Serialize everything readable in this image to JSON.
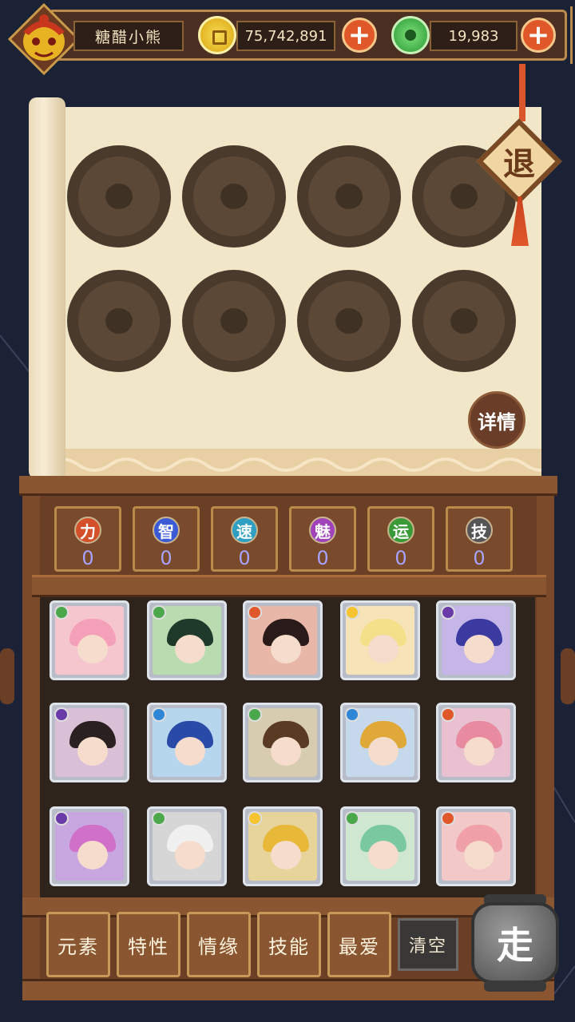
{
  "player": {
    "name": "糖醋小熊",
    "avatar_icon": "golden-mask-icon"
  },
  "currency": {
    "gold": {
      "value": "75,742,891",
      "icon": "gold-coin-icon",
      "color": "#f3c623"
    },
    "jade": {
      "value": "19,983",
      "icon": "jade-coin-icon",
      "color": "#3dbb4a"
    },
    "add_label": "+"
  },
  "exit_label": "退",
  "detail_label": "详情",
  "slot_count": 8,
  "stats": [
    {
      "label": "力",
      "value": "0",
      "color": "#d4502a"
    },
    {
      "label": "智",
      "value": "0",
      "color": "#3b5bd6"
    },
    {
      "label": "速",
      "value": "0",
      "color": "#2e9ec2"
    },
    {
      "label": "魅",
      "value": "0",
      "color": "#a043b8"
    },
    {
      "label": "运",
      "value": "0",
      "color": "#3a9a38"
    },
    {
      "label": "技",
      "value": "0",
      "color": "#555555"
    }
  ],
  "heroes": [
    {
      "element": "wood",
      "elem_color": "#4aa84a",
      "bg": "#f6c6cf",
      "hair": "#f4a0b8"
    },
    {
      "element": "wood",
      "elem_color": "#4aa84a",
      "bg": "#b8dbb0",
      "hair": "#1f3a2a"
    },
    {
      "element": "fire",
      "elem_color": "#e0582a",
      "bg": "#e9b7a8",
      "hair": "#2a1a1a"
    },
    {
      "element": "light",
      "elem_color": "#f5c430",
      "bg": "#f7e3b8",
      "hair": "#f4e08a"
    },
    {
      "element": "dark",
      "elem_color": "#6a3aa8",
      "bg": "#c6b6e8",
      "hair": "#3a3aa0"
    },
    {
      "element": "dark",
      "elem_color": "#6a3aa8",
      "bg": "#d9c0d6",
      "hair": "#2a2020"
    },
    {
      "element": "water",
      "elem_color": "#2e86d6",
      "bg": "#b6d6ee",
      "hair": "#2a4aa8"
    },
    {
      "element": "wood",
      "elem_color": "#4aa84a",
      "bg": "#d8ccb0",
      "hair": "#5a3a22"
    },
    {
      "element": "water",
      "elem_color": "#2e86d6",
      "bg": "#c6d8ec",
      "hair": "#e0a838"
    },
    {
      "element": "fire",
      "elem_color": "#e0582a",
      "bg": "#e8c0d0",
      "hair": "#e88aa0"
    },
    {
      "element": "dark",
      "elem_color": "#6a3aa8",
      "bg": "#c8a6e0",
      "hair": "#d070c8"
    },
    {
      "element": "wood",
      "elem_color": "#4aa84a",
      "bg": "#d6d6d6",
      "hair": "#f0f0f0"
    },
    {
      "element": "light",
      "elem_color": "#f5c430",
      "bg": "#e6d49a",
      "hair": "#e8b838"
    },
    {
      "element": "wood",
      "elem_color": "#4aa84a",
      "bg": "#cfe6d0",
      "hair": "#7ac8a0"
    },
    {
      "element": "fire",
      "elem_color": "#e0582a",
      "bg": "#f2c8c8",
      "hair": "#f0a0a8"
    }
  ],
  "filters": [
    "元素",
    "特性",
    "情缘",
    "技能",
    "最爱"
  ],
  "clear_label": "清空",
  "go_label": "走"
}
